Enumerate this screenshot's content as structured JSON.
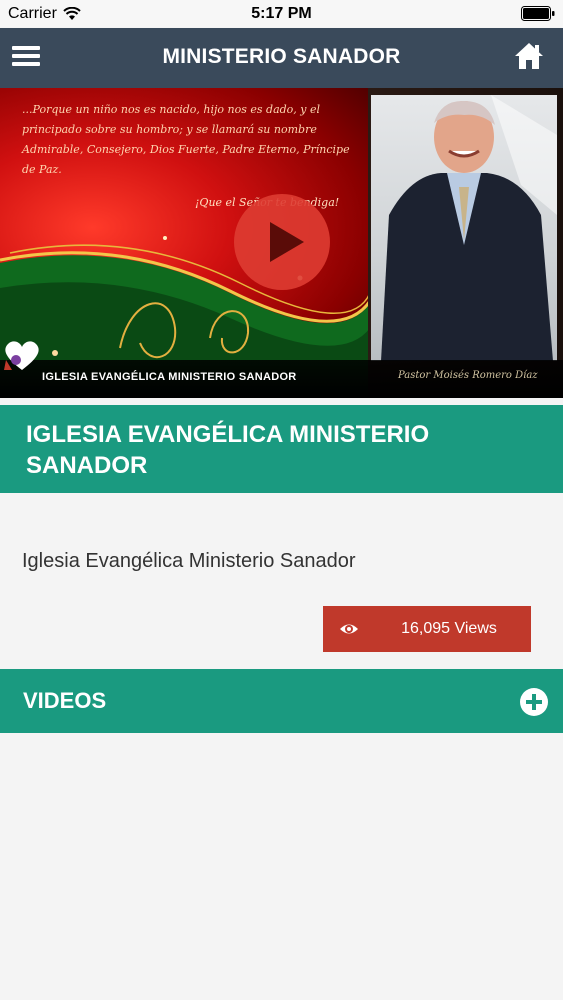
{
  "status_bar": {
    "carrier": "Carrier",
    "time": "5:17 PM"
  },
  "nav": {
    "title": "MINISTERIO SANADOR",
    "menu_icon": "hamburger-menu-icon",
    "home_icon": "home-icon"
  },
  "banner": {
    "scripture": "...Porque un niño nos es nacido, hijo nos es dado, y el principado sobre su hombro; y se llamará su nombre Admirable, Consejero, Dios Fuerte, Padre Eterno, Príncipe de Paz.",
    "scripture_tail": "¡Que el Señor te bendiga!",
    "church_name": "IGLESIA EVANGÉLICA MINISTERIO SANADOR",
    "signature": "Pastor Moisés Romero Díaz",
    "play_icon": "play-icon"
  },
  "heading": "IGLESIA EVANGÉLICA MINISTERIO SANADOR",
  "description": "Iglesia Evangélica Ministerio Sanador",
  "views": {
    "count": "16,095 Views",
    "icon": "eye-icon"
  },
  "videos": {
    "label": "VIDEOS",
    "icon": "plus-circle-icon"
  },
  "colors": {
    "nav": "#3a4a5b",
    "accent": "#1a9a80",
    "views": "#c0392b"
  }
}
